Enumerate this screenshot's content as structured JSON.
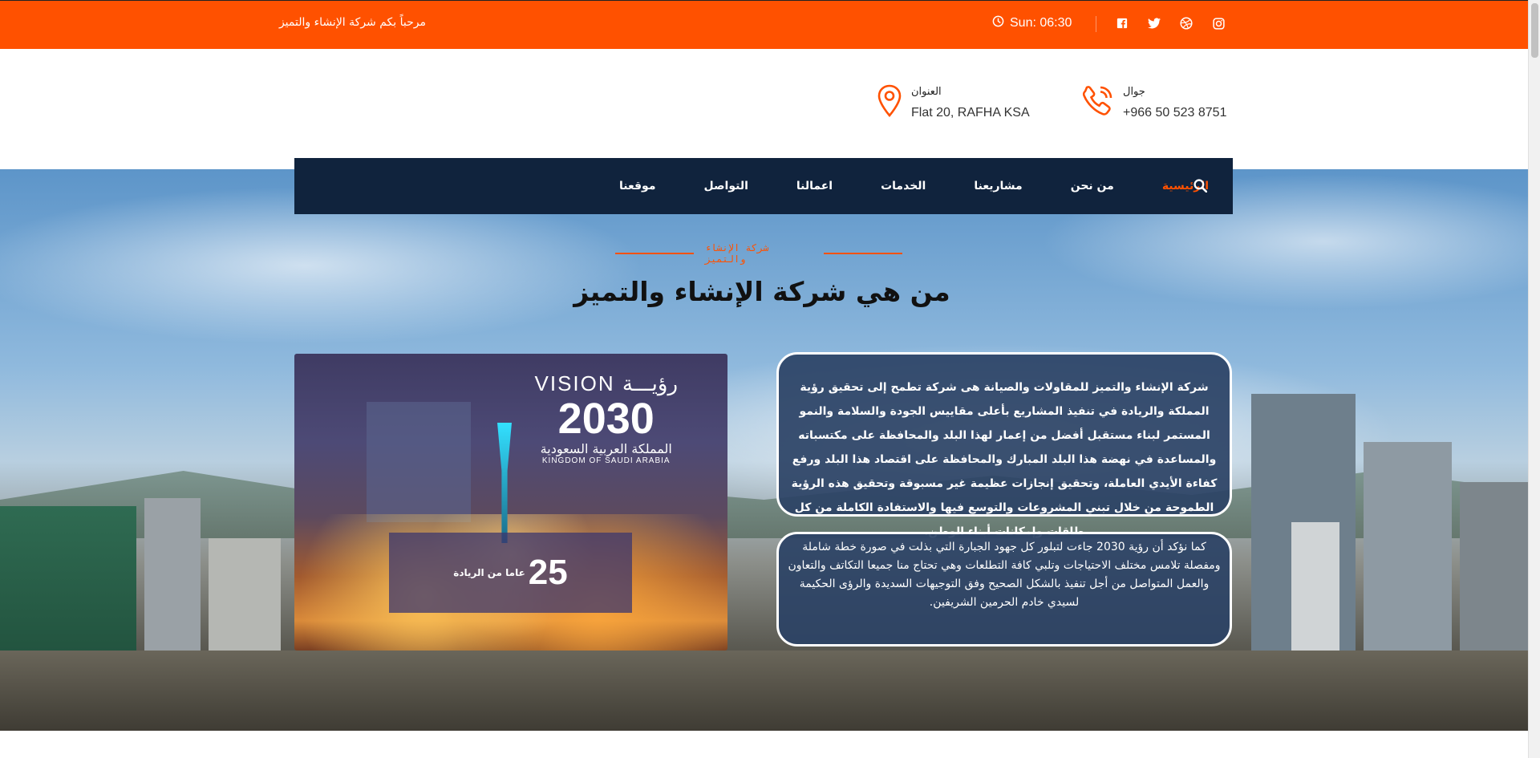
{
  "topbar": {
    "welcome": "مرحباً بكم شركة الإنشاء والتميز",
    "time": "Sun: 06:30",
    "social_icons": [
      "facebook-icon",
      "twitter-icon",
      "dribbble-icon",
      "instagram-icon"
    ]
  },
  "contacts": {
    "phone_label": "جوال",
    "phone_value": "+966 50 523 8751",
    "address_label": "العنوان",
    "address_value": "Flat 20, RAFHA KSA"
  },
  "nav": {
    "items": [
      {
        "label": "الرئيسية",
        "active": true
      },
      {
        "label": "من نحن"
      },
      {
        "label": "مشاريعنا"
      },
      {
        "label": "الخدمات"
      },
      {
        "label": "اعمالنا"
      },
      {
        "label": "التواصل"
      },
      {
        "label": "موقعنا"
      }
    ]
  },
  "about": {
    "eyebrow": "شركة الإنشاء والتميز",
    "title": "من هي شركة الإنشاء والتميز",
    "paragraph1": "شركة الإنشاء والتميز للمقاولات والصيانة هى شركة تطمح إلى تحقيق رؤية المملكة والريادة في تنفيذ المشاريع بأعلى مقاييس الجودة والسلامة والنمو المستمر لبناء مستقبل أفضل من إعمار لهذا البلد والمحافظة على مكتسباته والمساعدة في نهضة هذا البلد المبارك والمحافظة على اقتصاد هذا البلد ورفع كفاءة الأيدي العاملة، وتحقيق إنجازات عظيمة غير مسبوقة وتحقيق هذه الرؤية الطموحة من خلال تبني المشروعات والتوسع فيها والاستفادة الكاملة من كل طاقات وإمكانات أبناء الوطن.",
    "paragraph2": "كما نؤكد أن رؤية 2030 جاءت لتبلور كل جهود الجبارة التي بذلت في صورة خطة شاملة ومفصلة تلامس مختلف الاحتياجات وتلبي كافة التطلعات وهي تحتاج منا جميعا التكاتف والتعاون والعمل المتواصل من أجل تنفيذ بالشكل الصحيح وفق التوجيهات السديدة والرؤى الحكيمة لسيدي خادم الحرمين الشريفين.",
    "vision": {
      "line1": "VISION رؤيـــة",
      "year": "2030",
      "kingdom_ar": "المملكة العربية السعودية",
      "kingdom_en": "KINGDOM OF SAUDI ARABIA"
    },
    "badge_number": "25",
    "badge_label": "عاما من الريادة"
  }
}
